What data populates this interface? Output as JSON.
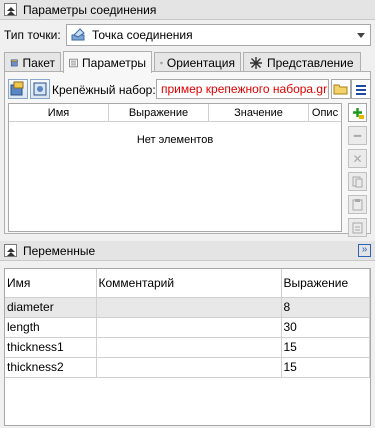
{
  "connection_panel": {
    "title": "Параметры соединения"
  },
  "point_type": {
    "label": "Тип точки:",
    "value": "Точка соединения"
  },
  "tabs": [
    {
      "label": "Пакет",
      "icon": "package-icon"
    },
    {
      "label": "Параметры",
      "icon": "parameters-icon"
    },
    {
      "label": "Ориентация",
      "icon": "orientation-icon"
    },
    {
      "label": "Представление",
      "icon": "representation-icon"
    }
  ],
  "fastener": {
    "label": "Крепёжный набор:",
    "value": "пример крепежного набора.grb"
  },
  "params_grid": {
    "columns": [
      "Имя",
      "Выражение",
      "Значение",
      "Опис"
    ],
    "empty_text": "Нет элементов"
  },
  "side_tools": [
    "add-icon",
    "remove-icon",
    "delete-icon",
    "copy-icon",
    "paste-icon",
    "clipboard-icon"
  ],
  "variables_panel": {
    "title": "Переменные"
  },
  "variables": {
    "columns": [
      "Имя",
      "Комментарий",
      "Выражение"
    ],
    "rows": [
      {
        "name": "diameter",
        "comment": "",
        "expression": "8"
      },
      {
        "name": "length",
        "comment": "",
        "expression": "30"
      },
      {
        "name": "thickness1",
        "comment": "",
        "expression": "15"
      },
      {
        "name": "thickness2",
        "comment": "",
        "expression": "15"
      }
    ]
  },
  "colors": {
    "fastener_text": "#e00000",
    "accent": "#2a63b8"
  }
}
